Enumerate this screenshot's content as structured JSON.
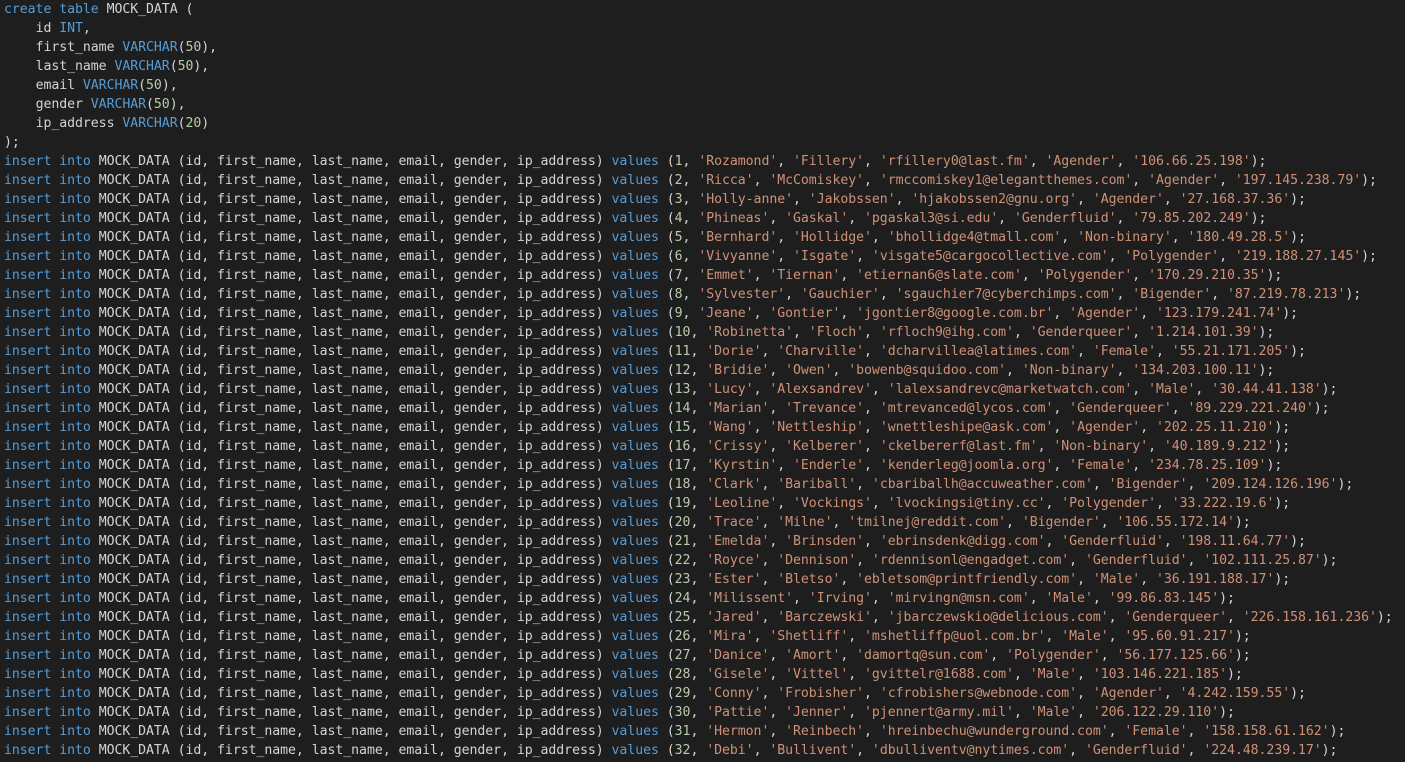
{
  "colors": {
    "background": "#1e1e1e",
    "keyword": "#569cd6",
    "type": "#569cd6",
    "number": "#b5cea8",
    "string": "#ce9178",
    "plain": "#d4d4d4"
  },
  "editor": {
    "table_name": "MOCK_DATA",
    "create_keywords": "create table",
    "open_paren": " (",
    "close_paren": ");",
    "columns": [
      {
        "name": "id",
        "type": "INT",
        "size": "",
        "sep": ","
      },
      {
        "name": "first_name",
        "type": "VARCHAR",
        "size": "50",
        "sep": ","
      },
      {
        "name": "last_name",
        "type": "VARCHAR",
        "size": "50",
        "sep": ","
      },
      {
        "name": "email",
        "type": "VARCHAR",
        "size": "50",
        "sep": ","
      },
      {
        "name": "gender",
        "type": "VARCHAR",
        "size": "50",
        "sep": ","
      },
      {
        "name": "ip_address",
        "type": "VARCHAR",
        "size": "20",
        "sep": ""
      }
    ],
    "insert_keywords": "insert into",
    "column_list": "(id, first_name, last_name, email, gender, ip_address)",
    "values_keyword": "values",
    "rows": [
      {
        "id": "1",
        "first_name": "Rozamond",
        "last_name": "Fillery",
        "email": "rfillery0@last.fm",
        "gender": "Agender",
        "ip_address": "106.66.25.198"
      },
      {
        "id": "2",
        "first_name": "Ricca",
        "last_name": "McComiskey",
        "email": "rmccomiskey1@elegantthemes.com",
        "gender": "Agender",
        "ip_address": "197.145.238.79"
      },
      {
        "id": "3",
        "first_name": "Holly-anne",
        "last_name": "Jakobssen",
        "email": "hjakobssen2@gnu.org",
        "gender": "Agender",
        "ip_address": "27.168.37.36"
      },
      {
        "id": "4",
        "first_name": "Phineas",
        "last_name": "Gaskal",
        "email": "pgaskal3@si.edu",
        "gender": "Genderfluid",
        "ip_address": "79.85.202.249"
      },
      {
        "id": "5",
        "first_name": "Bernhard",
        "last_name": "Hollidge",
        "email": "bhollidge4@tmall.com",
        "gender": "Non-binary",
        "ip_address": "180.49.28.5"
      },
      {
        "id": "6",
        "first_name": "Vivyanne",
        "last_name": "Isgate",
        "email": "visgate5@cargocollective.com",
        "gender": "Polygender",
        "ip_address": "219.188.27.145"
      },
      {
        "id": "7",
        "first_name": "Emmet",
        "last_name": "Tiernan",
        "email": "etiernan6@slate.com",
        "gender": "Polygender",
        "ip_address": "170.29.210.35"
      },
      {
        "id": "8",
        "first_name": "Sylvester",
        "last_name": "Gauchier",
        "email": "sgauchier7@cyberchimps.com",
        "gender": "Bigender",
        "ip_address": "87.219.78.213"
      },
      {
        "id": "9",
        "first_name": "Jeane",
        "last_name": "Gontier",
        "email": "jgontier8@google.com.br",
        "gender": "Agender",
        "ip_address": "123.179.241.74"
      },
      {
        "id": "10",
        "first_name": "Robinetta",
        "last_name": "Floch",
        "email": "rfloch9@ihg.com",
        "gender": "Genderqueer",
        "ip_address": "1.214.101.39"
      },
      {
        "id": "11",
        "first_name": "Dorie",
        "last_name": "Charville",
        "email": "dcharvillea@latimes.com",
        "gender": "Female",
        "ip_address": "55.21.171.205"
      },
      {
        "id": "12",
        "first_name": "Bridie",
        "last_name": "Owen",
        "email": "bowenb@squidoo.com",
        "gender": "Non-binary",
        "ip_address": "134.203.100.11"
      },
      {
        "id": "13",
        "first_name": "Lucy",
        "last_name": "Alexsandrev",
        "email": "lalexsandrevc@marketwatch.com",
        "gender": "Male",
        "ip_address": "30.44.41.138"
      },
      {
        "id": "14",
        "first_name": "Marian",
        "last_name": "Trevance",
        "email": "mtrevanced@lycos.com",
        "gender": "Genderqueer",
        "ip_address": "89.229.221.240"
      },
      {
        "id": "15",
        "first_name": "Wang",
        "last_name": "Nettleship",
        "email": "wnettleshipe@ask.com",
        "gender": "Agender",
        "ip_address": "202.25.11.210"
      },
      {
        "id": "16",
        "first_name": "Crissy",
        "last_name": "Kelberer",
        "email": "ckelbererf@last.fm",
        "gender": "Non-binary",
        "ip_address": "40.189.9.212"
      },
      {
        "id": "17",
        "first_name": "Kyrstin",
        "last_name": "Enderle",
        "email": "kenderleg@joomla.org",
        "gender": "Female",
        "ip_address": "234.78.25.109"
      },
      {
        "id": "18",
        "first_name": "Clark",
        "last_name": "Bariball",
        "email": "cbariballh@accuweather.com",
        "gender": "Bigender",
        "ip_address": "209.124.126.196"
      },
      {
        "id": "19",
        "first_name": "Leoline",
        "last_name": "Vockings",
        "email": "lvockingsi@tiny.cc",
        "gender": "Polygender",
        "ip_address": "33.222.19.6"
      },
      {
        "id": "20",
        "first_name": "Trace",
        "last_name": "Milne",
        "email": "tmilnej@reddit.com",
        "gender": "Bigender",
        "ip_address": "106.55.172.14"
      },
      {
        "id": "21",
        "first_name": "Emelda",
        "last_name": "Brinsden",
        "email": "ebrinsdenk@digg.com",
        "gender": "Genderfluid",
        "ip_address": "198.11.64.77"
      },
      {
        "id": "22",
        "first_name": "Royce",
        "last_name": "Dennison",
        "email": "rdennisonl@engadget.com",
        "gender": "Genderfluid",
        "ip_address": "102.111.25.87"
      },
      {
        "id": "23",
        "first_name": "Ester",
        "last_name": "Bletso",
        "email": "ebletsom@printfriendly.com",
        "gender": "Male",
        "ip_address": "36.191.188.17"
      },
      {
        "id": "24",
        "first_name": "Milissent",
        "last_name": "Irving",
        "email": "mirvingn@msn.com",
        "gender": "Male",
        "ip_address": "99.86.83.145"
      },
      {
        "id": "25",
        "first_name": "Jared",
        "last_name": "Barczewski",
        "email": "jbarczewskio@delicious.com",
        "gender": "Genderqueer",
        "ip_address": "226.158.161.236"
      },
      {
        "id": "26",
        "first_name": "Mira",
        "last_name": "Shetliff",
        "email": "mshetliffp@uol.com.br",
        "gender": "Male",
        "ip_address": "95.60.91.217"
      },
      {
        "id": "27",
        "first_name": "Danice",
        "last_name": "Amort",
        "email": "damortq@sun.com",
        "gender": "Polygender",
        "ip_address": "56.177.125.66"
      },
      {
        "id": "28",
        "first_name": "Gisele",
        "last_name": "Vittel",
        "email": "gvittelr@1688.com",
        "gender": "Male",
        "ip_address": "103.146.221.185"
      },
      {
        "id": "29",
        "first_name": "Conny",
        "last_name": "Frobisher",
        "email": "cfrobishers@webnode.com",
        "gender": "Agender",
        "ip_address": "4.242.159.55"
      },
      {
        "id": "30",
        "first_name": "Pattie",
        "last_name": "Jenner",
        "email": "pjennert@army.mil",
        "gender": "Male",
        "ip_address": "206.122.29.110"
      },
      {
        "id": "31",
        "first_name": "Hermon",
        "last_name": "Reinbech",
        "email": "hreinbechu@wunderground.com",
        "gender": "Female",
        "ip_address": "158.158.61.162"
      },
      {
        "id": "32",
        "first_name": "Debi",
        "last_name": "Bullivent",
        "email": "dbulliventv@nytimes.com",
        "gender": "Genderfluid",
        "ip_address": "224.48.239.17"
      }
    ]
  }
}
